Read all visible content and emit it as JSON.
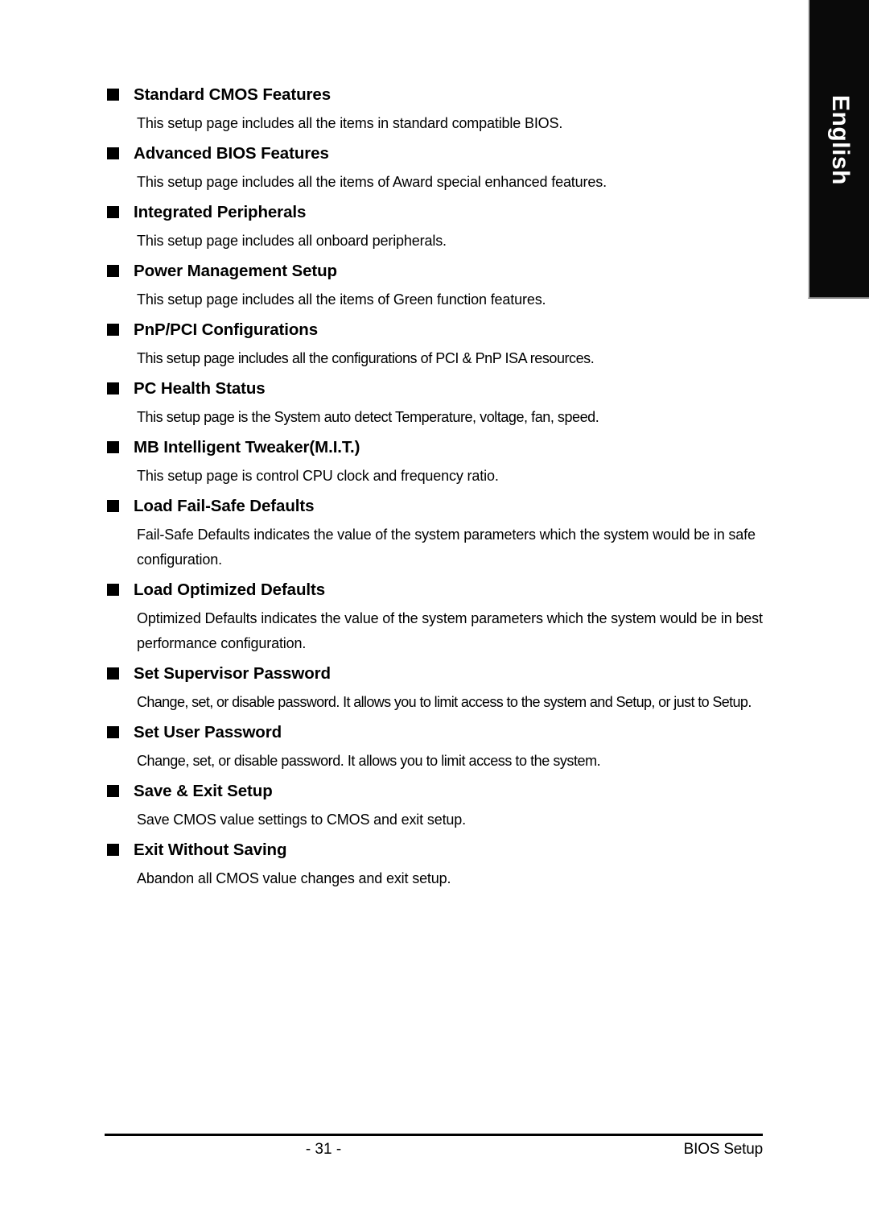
{
  "language_tab": {
    "label": "English"
  },
  "page": {
    "bullet_icon": "filled-square-bullet",
    "entries": [
      {
        "heading": "Standard CMOS Features",
        "body": "This setup page includes all the items in standard compatible BIOS."
      },
      {
        "heading": "Advanced BIOS Features",
        "body": "This setup page includes all the items of Award special enhanced features."
      },
      {
        "heading": "Integrated Peripherals",
        "body": "This setup page includes all onboard peripherals."
      },
      {
        "heading": "Power Management Setup",
        "body": "This setup page includes all the items of Green function features."
      },
      {
        "heading": "PnP/PCI Configurations",
        "body": "This setup page includes all the configurations of PCI & PnP ISA resources."
      },
      {
        "heading": "PC Health Status",
        "body": "This setup page is the System auto detect Temperature, voltage, fan, speed."
      },
      {
        "heading": "MB Intelligent Tweaker(M.I.T.)",
        "body": "This setup page is control CPU clock and frequency ratio."
      },
      {
        "heading": "Load Fail-Safe Defaults",
        "body": "Fail-Safe Defaults indicates the value of the system parameters which the system would be in safe configuration."
      },
      {
        "heading": "Load Optimized Defaults",
        "body": "Optimized Defaults indicates the value of the system parameters which the system would be in best performance configuration."
      },
      {
        "heading": "Set Supervisor Password",
        "body": "Change, set, or disable password. It allows you to limit access to the system and Setup, or just to Setup."
      },
      {
        "heading": "Set User Password",
        "body": "Change, set, or disable password. It allows you to limit access to the system."
      },
      {
        "heading": "Save & Exit Setup",
        "body": "Save CMOS value settings to CMOS and exit setup."
      },
      {
        "heading": "Exit Without Saving",
        "body": "Abandon all CMOS value changes and exit setup."
      }
    ]
  },
  "footer": {
    "page_number": "- 31 -",
    "section_label": "BIOS Setup"
  }
}
